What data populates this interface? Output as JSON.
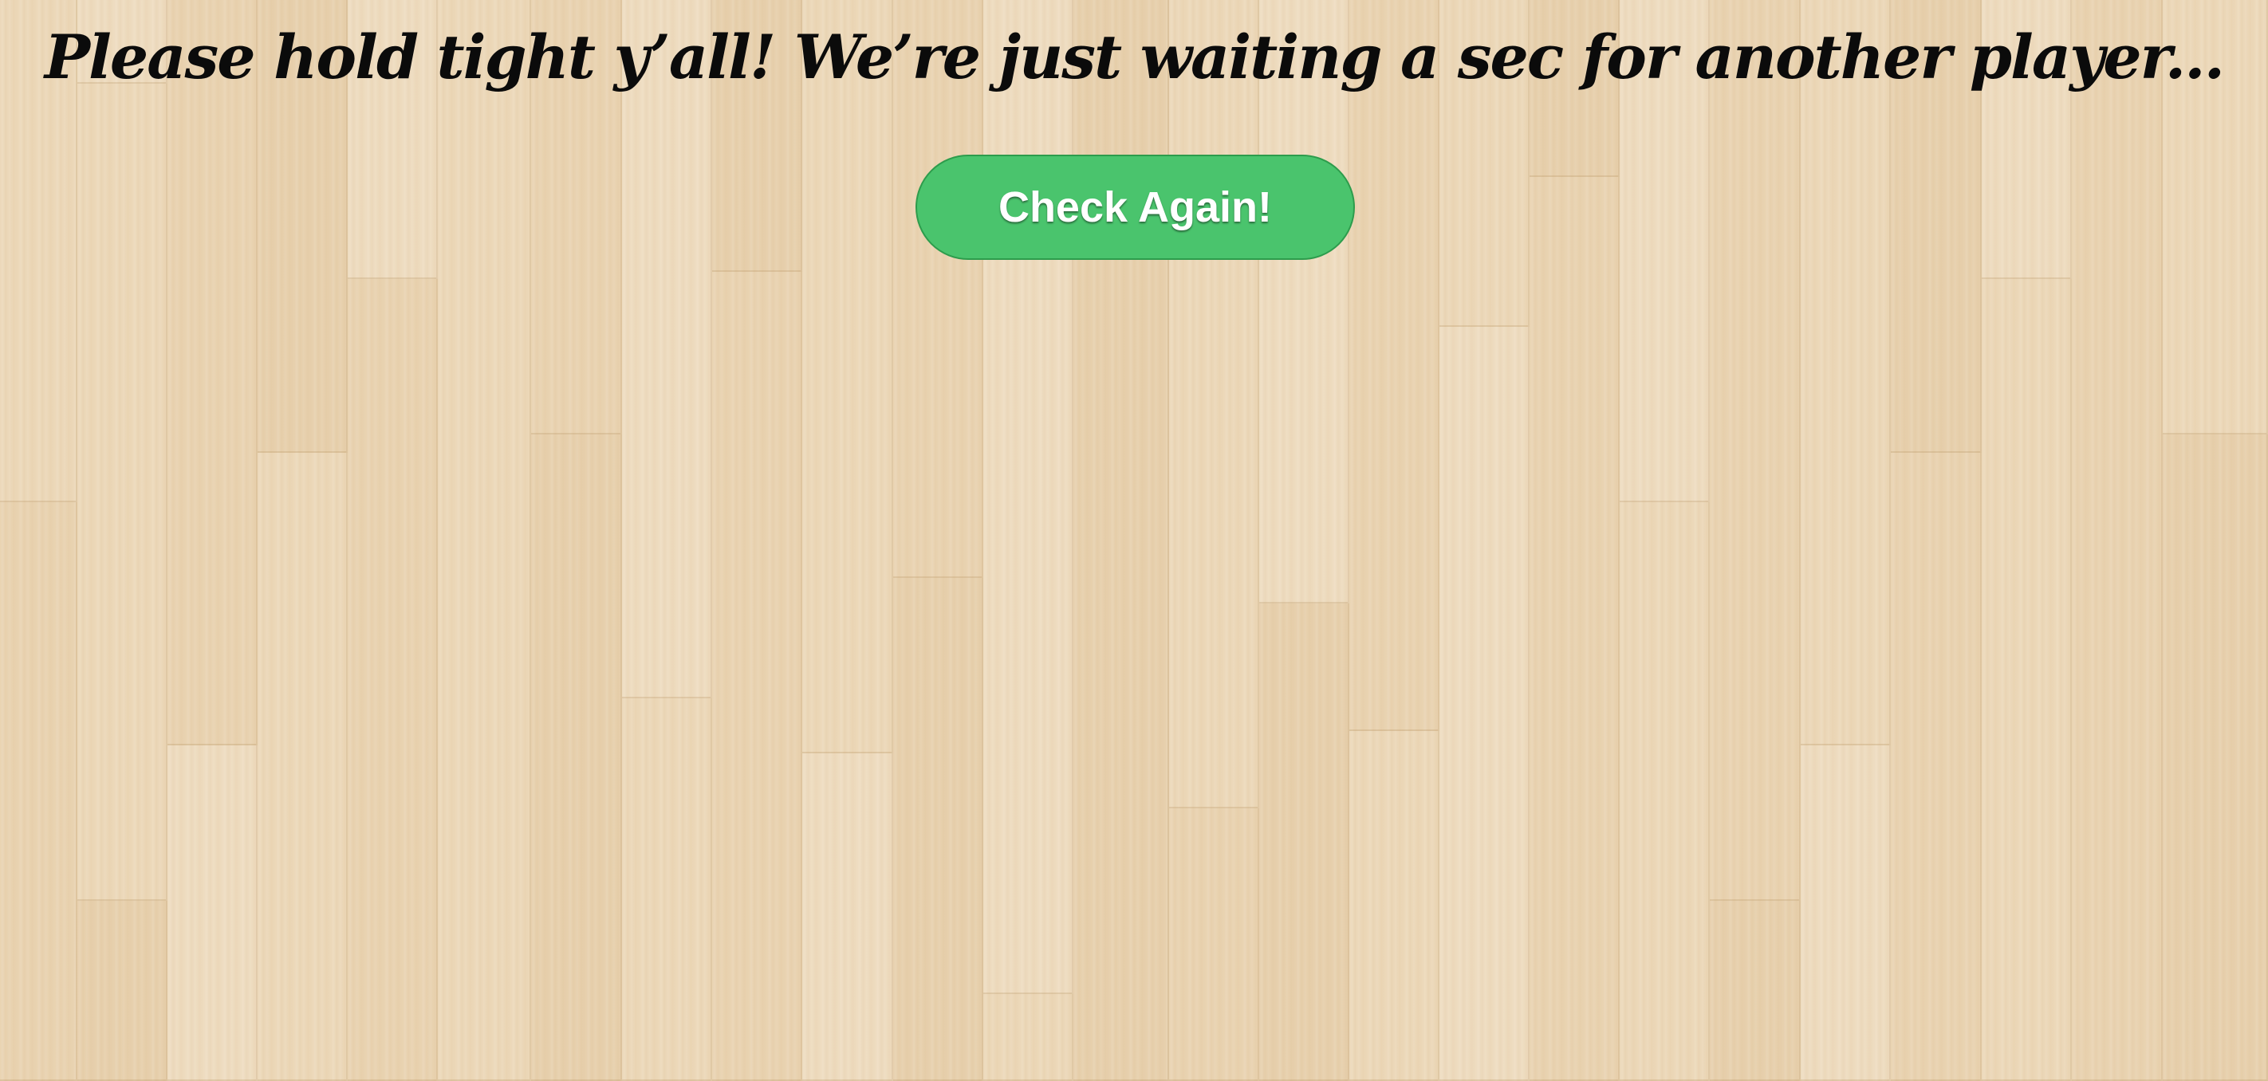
{
  "waiting_screen": {
    "heading": "Please hold tight y’all! We’re just waiting a sec for another player...",
    "check_again_label": "Check Again!"
  },
  "colors": {
    "floor_wood": "#ebd6b6",
    "button_green": "#4ac46d",
    "button_border": "#2d9c4c",
    "heading_text": "#0b0b0b",
    "button_text": "#ffffff"
  }
}
